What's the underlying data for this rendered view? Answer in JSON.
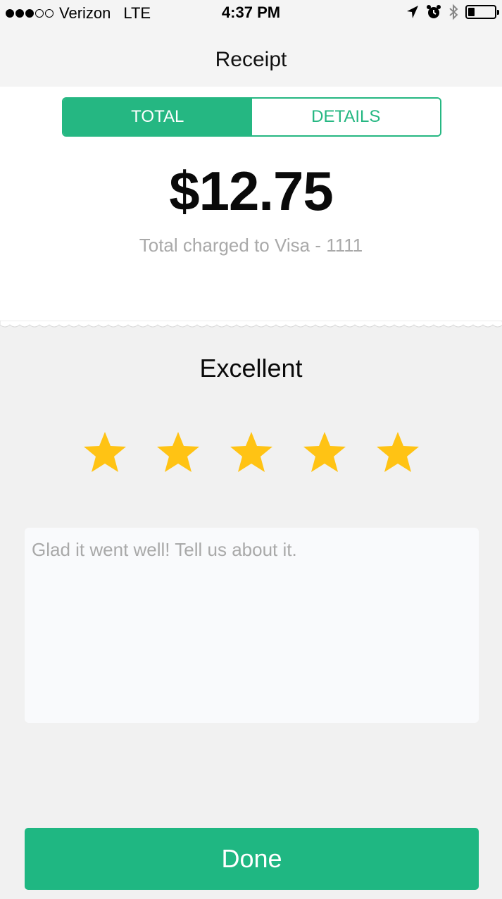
{
  "status_bar": {
    "signal_dots_filled": 3,
    "signal_dots_total": 5,
    "carrier": "Verizon",
    "network": "LTE",
    "time": "4:37 PM",
    "icons": [
      "location-arrow-icon",
      "alarm-icon",
      "bluetooth-icon",
      "battery-icon"
    ],
    "battery_level": 0.25
  },
  "nav": {
    "title": "Receipt"
  },
  "tabs": [
    {
      "label": "TOTAL",
      "active": true
    },
    {
      "label": "DETAILS",
      "active": false
    }
  ],
  "receipt": {
    "total": "$12.75",
    "caption": "Total charged to Visa - 1111"
  },
  "rating": {
    "label": "Excellent",
    "stars_filled": 5,
    "stars_total": 5
  },
  "feedback": {
    "placeholder": "Glad it went well! Tell us about it.",
    "value": ""
  },
  "done_button": {
    "label": "Done"
  },
  "colors": {
    "accent": "#25b782",
    "star": "#ffc314",
    "background": "#f1f1f1",
    "caption": "#a9a9a9"
  }
}
